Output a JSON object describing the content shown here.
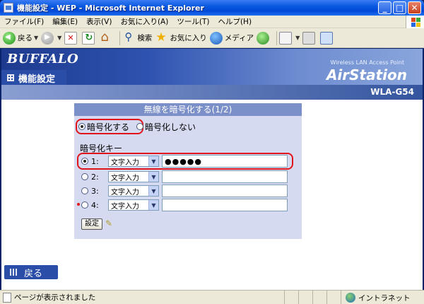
{
  "window": {
    "title": "機能設定 - WEP - Microsoft Internet Explorer",
    "buttons": [
      "_",
      "□",
      "✕"
    ]
  },
  "menu": [
    "ファイル(F)",
    "編集(E)",
    "表示(V)",
    "お気に入り(A)",
    "ツール(T)",
    "ヘルプ(H)"
  ],
  "toolbar": {
    "back_label": "戻る",
    "search_label": "検索",
    "favorites_label": "お気に入り",
    "media_label": "メディア"
  },
  "header": {
    "brand": "BUFFALO",
    "section": "機能設定",
    "tagline": "Wireless LAN Access Point",
    "product": "AirStation",
    "model": "WLA-G54"
  },
  "panel": {
    "title": "無線を暗号化する(1/2)",
    "encrypt_on_label": "暗号化する",
    "encrypt_off_label": "暗号化しない",
    "encrypt_selected": "on",
    "key_heading": "暗号化キー",
    "keys": [
      {
        "num": "1:",
        "mode": "文字入力",
        "value": "●●●●●",
        "selected": true
      },
      {
        "num": "2:",
        "mode": "文字入力",
        "value": "",
        "selected": false
      },
      {
        "num": "3:",
        "mode": "文字入力",
        "value": "",
        "selected": false
      },
      {
        "num": "4:",
        "mode": "文字入力",
        "value": "",
        "selected": false
      }
    ],
    "set_button": "設定"
  },
  "back_button": "戻る",
  "status": {
    "message": "ページが表示されました",
    "zone": "イントラネット"
  }
}
